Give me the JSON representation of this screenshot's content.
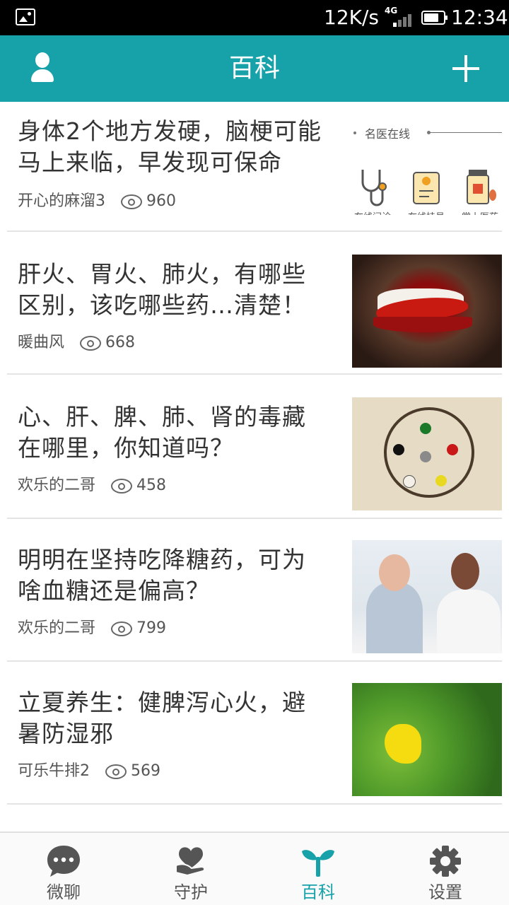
{
  "status_bar": {
    "speed": "12K/s",
    "network": "4G",
    "time": "12:34"
  },
  "header": {
    "title": "百科",
    "left_icon": "user-icon",
    "right_icon": "plus-icon"
  },
  "ad_banner": {
    "title": "名医在线",
    "services": [
      {
        "label": "在线问诊",
        "icon": "stethoscope-icon"
      },
      {
        "label": "在线挂号",
        "icon": "clipboard-icon"
      },
      {
        "label": "掌上医药",
        "icon": "medicine-bottle-icon"
      }
    ]
  },
  "articles": [
    {
      "title": "身体2个地方发硬，脑梗可能马上来临，早发现可保命",
      "author": "开心的麻溜3",
      "views": "960",
      "thumb": "ad"
    },
    {
      "title": "肝火、胃火、肺火，有哪些区别，该吃哪些药…清楚！",
      "author": "暖曲风",
      "views": "668",
      "thumb": "chili"
    },
    {
      "title": "心、肝、脾、肺、肾的毒藏在哪里，你知道吗？",
      "author": "欢乐的二哥",
      "views": "458",
      "thumb": "wheel"
    },
    {
      "title": "明明在坚持吃降糖药，可为啥血糖还是偏高？",
      "author": "欢乐的二哥",
      "views": "799",
      "thumb": "doctor"
    },
    {
      "title": "立夏养生：健脾泻心火，避暑防湿邪",
      "author": "可乐牛排2",
      "views": "569",
      "thumb": "flower"
    }
  ],
  "tabs": [
    {
      "label": "微聊",
      "icon": "chat-bubble-icon",
      "active": false
    },
    {
      "label": "守护",
      "icon": "heart-hand-icon",
      "active": false
    },
    {
      "label": "百科",
      "icon": "sprout-icon",
      "active": true
    },
    {
      "label": "设置",
      "icon": "gear-icon",
      "active": false
    }
  ],
  "colors": {
    "accent": "#17a1a9",
    "text": "#333333",
    "status_bar": "#000000"
  }
}
